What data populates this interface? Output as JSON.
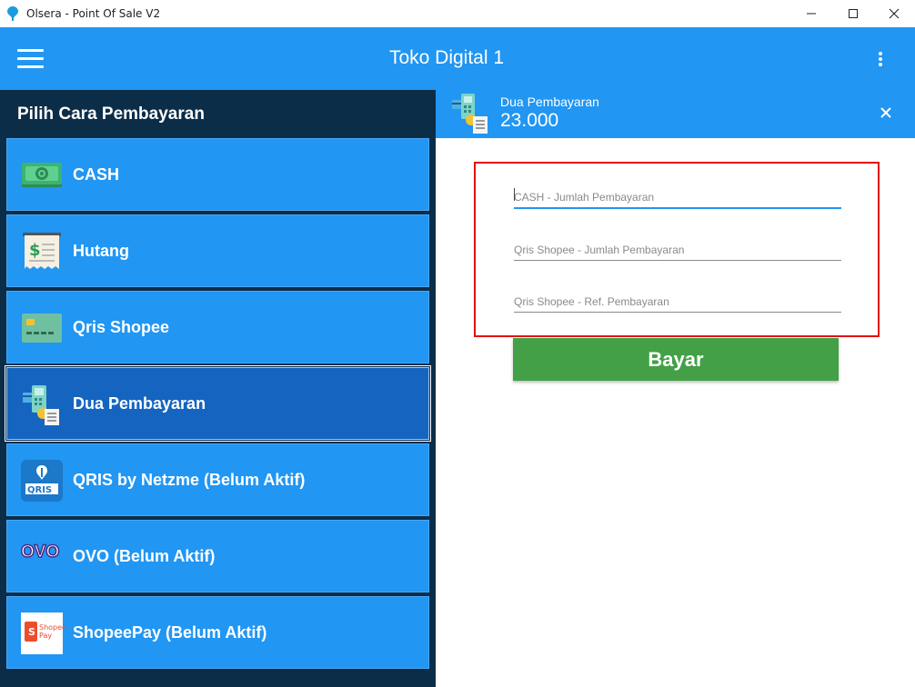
{
  "window": {
    "title": "Olsera - Point Of Sale V2",
    "controls": [
      "minimize-icon",
      "maximize-icon",
      "close-icon"
    ]
  },
  "header": {
    "store_name": "Toko Digital 1",
    "menu_icon": "hamburger-icon",
    "more_icon": "more-vertical-icon"
  },
  "payment_panel": {
    "title": "Pilih Cara Pembayaran",
    "methods": [
      {
        "label": "CASH",
        "icon": "cash-icon"
      },
      {
        "label": "Hutang",
        "icon": "receipt-icon"
      },
      {
        "label": "Qris Shopee",
        "icon": "card-icon"
      },
      {
        "label": "Dua Pembayaran",
        "icon": "split-payment-icon",
        "selected": true
      },
      {
        "label": "QRIS by Netzme (Belum Aktif)",
        "icon": "qris-icon"
      },
      {
        "label": "OVO (Belum Aktif)",
        "icon": "ovo-icon",
        "icon_text": "OVO"
      },
      {
        "label": "ShopeePay (Belum Aktif)",
        "icon": "shopeepay-icon",
        "icon_text": "Shopee Pay"
      }
    ]
  },
  "detail": {
    "method_name": "Dua Pembayaran",
    "amount": "23.000",
    "fields": [
      {
        "placeholder": "CASH - Jumlah Pembayaran",
        "value": ""
      },
      {
        "placeholder": "Qris Shopee - Jumlah Pembayaran",
        "value": ""
      },
      {
        "placeholder": "Qris Shopee - Ref. Pembayaran",
        "value": ""
      }
    ],
    "pay_button": "Bayar"
  },
  "colors": {
    "primary": "#2196f3",
    "panel_dark": "#0c2d48",
    "selected": "#1565c0",
    "pay_green": "#43a047",
    "highlight_border": "#e31010"
  }
}
